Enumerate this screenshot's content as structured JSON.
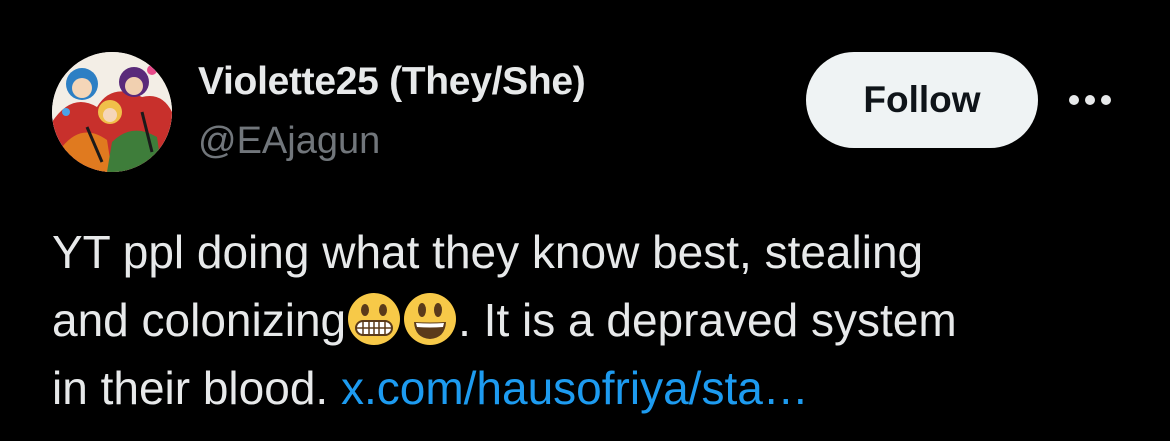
{
  "author": {
    "display_name": "Violette25 (They/She)",
    "handle": "@EAjagun",
    "avatar": "anime-character-avatar"
  },
  "actions": {
    "follow_label": "Follow",
    "more_icon": "more-horizontal-icon"
  },
  "tweet": {
    "line1": "YT ppl doing what they know best, stealing",
    "line2_before": "and colonizing",
    "emoji1": "grimacing-face",
    "emoji2": "grinning-face-big-eyes",
    "line2_after": ". It is a depraved system",
    "line3_before": "in their blood.",
    "link_text": "x.com/hausofriya/sta…"
  },
  "colors": {
    "background": "#000000",
    "text": "#e7e9ea",
    "secondary_text": "#71767b",
    "link": "#1d9bf0",
    "follow_bg": "#eff3f4"
  }
}
